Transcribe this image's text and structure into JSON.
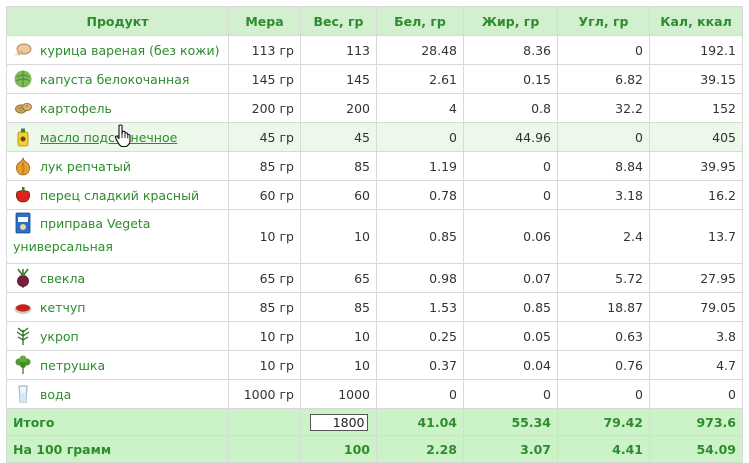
{
  "header": {
    "product": "Продукт",
    "measure": "Мера",
    "weight": "Вес, гр",
    "protein": "Бел, гр",
    "fat": "Жир, гр",
    "carbs": "Угл, гр",
    "calories": "Кал, ккал"
  },
  "rows": [
    {
      "name": "курица вареная (без кожи)",
      "icon": "chicken-icon",
      "measure": "113 гр",
      "weight": "113",
      "protein": "28.48",
      "fat": "8.36",
      "carbs": "0",
      "kcal": "192.1"
    },
    {
      "name": "капуста белокочанная",
      "icon": "cabbage-icon",
      "measure": "145 гр",
      "weight": "145",
      "protein": "2.61",
      "fat": "0.15",
      "carbs": "6.82",
      "kcal": "39.15"
    },
    {
      "name": "картофель",
      "icon": "potato-icon",
      "measure": "200 гр",
      "weight": "200",
      "protein": "4",
      "fat": "0.8",
      "carbs": "32.2",
      "kcal": "152"
    },
    {
      "name": "масло подсолнечное",
      "icon": "sunflower-oil-icon",
      "measure": "45 гр",
      "weight": "45",
      "protein": "0",
      "fat": "44.96",
      "carbs": "0",
      "kcal": "405"
    },
    {
      "name": "лук репчатый",
      "icon": "onion-icon",
      "measure": "85 гр",
      "weight": "85",
      "protein": "1.19",
      "fat": "0",
      "carbs": "8.84",
      "kcal": "39.95"
    },
    {
      "name": "перец сладкий красный",
      "icon": "red-pepper-icon",
      "measure": "60 гр",
      "weight": "60",
      "protein": "0.78",
      "fat": "0",
      "carbs": "3.18",
      "kcal": "16.2"
    },
    {
      "name": "приправа Vegeta универсальная",
      "icon": "vegeta-seasoning-icon",
      "measure": "10 гр",
      "weight": "10",
      "protein": "0.85",
      "fat": "0.06",
      "carbs": "2.4",
      "kcal": "13.7"
    },
    {
      "name": "свекла",
      "icon": "beet-icon",
      "measure": "65 гр",
      "weight": "65",
      "protein": "0.98",
      "fat": "0.07",
      "carbs": "5.72",
      "kcal": "27.95"
    },
    {
      "name": "кетчуп",
      "icon": "ketchup-icon",
      "measure": "85 гр",
      "weight": "85",
      "protein": "1.53",
      "fat": "0.85",
      "carbs": "18.87",
      "kcal": "79.05"
    },
    {
      "name": "укроп",
      "icon": "dill-icon",
      "measure": "10 гр",
      "weight": "10",
      "protein": "0.25",
      "fat": "0.05",
      "carbs": "0.63",
      "kcal": "3.8"
    },
    {
      "name": "петрушка",
      "icon": "parsley-icon",
      "measure": "10 гр",
      "weight": "10",
      "protein": "0.37",
      "fat": "0.04",
      "carbs": "0.76",
      "kcal": "4.7"
    },
    {
      "name": "вода",
      "icon": "water-glass-icon",
      "measure": "1000 гр",
      "weight": "1000",
      "protein": "0",
      "fat": "0",
      "carbs": "0",
      "kcal": "0"
    }
  ],
  "totals": {
    "label": "Итого",
    "weight_value": "1800",
    "protein": "41.04",
    "fat": "55.34",
    "carbs": "79.42",
    "kcal": "973.6"
  },
  "per100": {
    "label": "На 100 грамм",
    "weight": "100",
    "protein": "2.28",
    "fat": "3.07",
    "carbs": "4.41",
    "kcal": "54.09"
  },
  "colors": {
    "header_bg": "#d2f0cf",
    "accent_green": "#2e8b2e",
    "footer_bg": "#ccf2c8",
    "hover_row_bg": "#ecf8ea",
    "border": "#d9d9d9"
  }
}
